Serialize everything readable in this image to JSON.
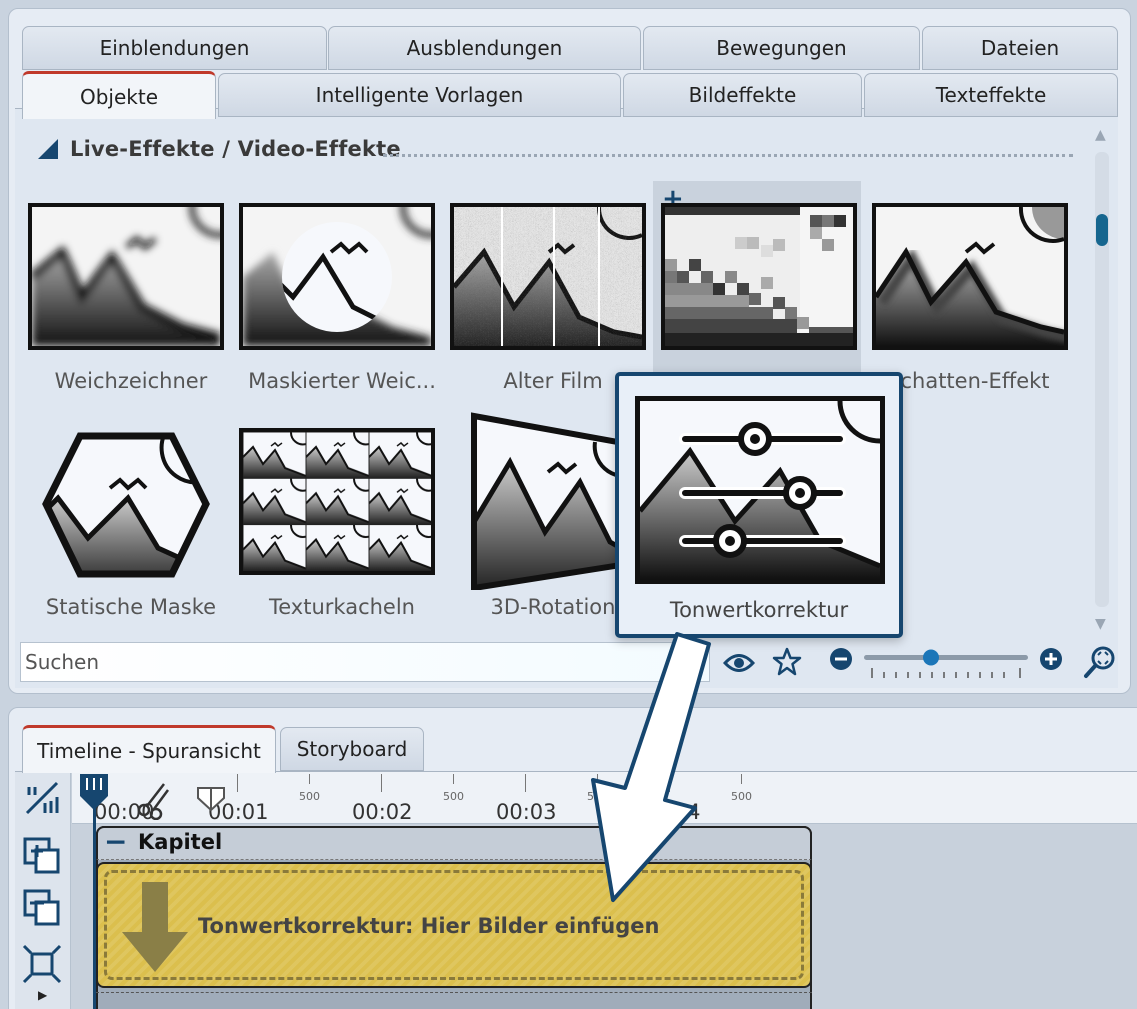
{
  "tabs_row1": [
    "Einblendungen",
    "Ausblendungen",
    "Bewegungen",
    "Dateien"
  ],
  "tabs_row2": [
    "Objekte",
    "Intelligente Vorlagen",
    "Bildeffekte",
    "Texteffekte"
  ],
  "active_tab": "Objekte",
  "section": {
    "title": "Live-Effekte / Video-Effekte"
  },
  "effects": [
    {
      "label": "Weichzeichner",
      "icon": "blur-effect-icon"
    },
    {
      "label": "Maskierter Weic...",
      "icon": "masked-blur-icon"
    },
    {
      "label": "Alter Film",
      "icon": "old-film-icon"
    },
    {
      "label": "",
      "icon": "pixelate-icon"
    },
    {
      "label": "chatten-Effekt",
      "icon": "shadow-effect-icon"
    },
    {
      "label": "Statische Maske",
      "icon": "static-mask-icon"
    },
    {
      "label": "Texturkacheln",
      "icon": "texture-tiles-icon"
    },
    {
      "label": "3D-Rotation",
      "icon": "3d-rotation-icon"
    }
  ],
  "popup": {
    "label": "Tonwertkorrektur",
    "icon": "tone-correction-icon"
  },
  "search": {
    "placeholder": "Suchen"
  },
  "colors": {
    "accent": "#16466f",
    "active_tab_top": "#c0392b",
    "drop_zone": "#dbbf4d"
  },
  "bottom_tabs": [
    "Timeline - Spuransicht",
    "Storyboard"
  ],
  "active_bottom_tab": "Timeline - Spuransicht",
  "ruler": {
    "labels": [
      "00:00",
      "00:01",
      "00:02",
      "00:03",
      "00:04"
    ],
    "sub_labels": [
      "500",
      "500",
      "500",
      "500"
    ]
  },
  "timeline": {
    "chapter_title": "Kapitel",
    "drop_text": "Tonwertkorrektur: Hier Bilder einfügen"
  }
}
